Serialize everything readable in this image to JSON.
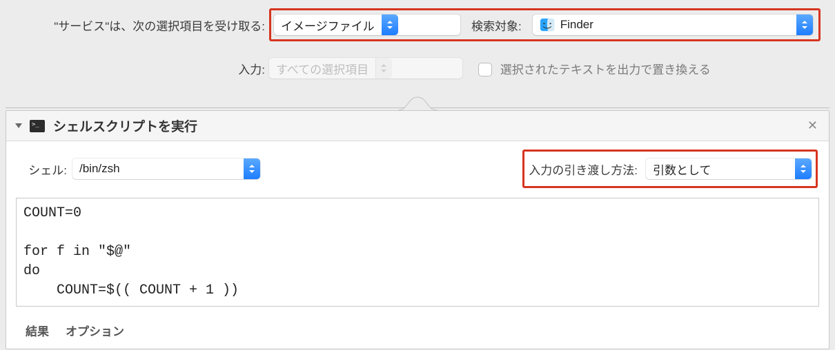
{
  "top": {
    "service_label": "\"サービス\"は、次の選択項目を受け取る:",
    "receives_popup": "イメージファイル",
    "search_in_label": "検索対象:",
    "search_in_value": "Finder",
    "input_label": "入力:",
    "input_popup": "すべての選択項目",
    "replace_checkbox_label": "選択されたテキストを出力で置き換える",
    "replace_checked": false
  },
  "action": {
    "title": "シェルスクリプトを実行",
    "shell_label": "シェル:",
    "shell_value": "/bin/zsh",
    "pass_label": "入力の引き渡し方法:",
    "pass_value": "引数として",
    "script": "COUNT=0\n\nfor f in \"$@\"\ndo\n    COUNT=$(( COUNT + 1 ))",
    "footer": {
      "results": "結果",
      "options": "オプション"
    }
  }
}
